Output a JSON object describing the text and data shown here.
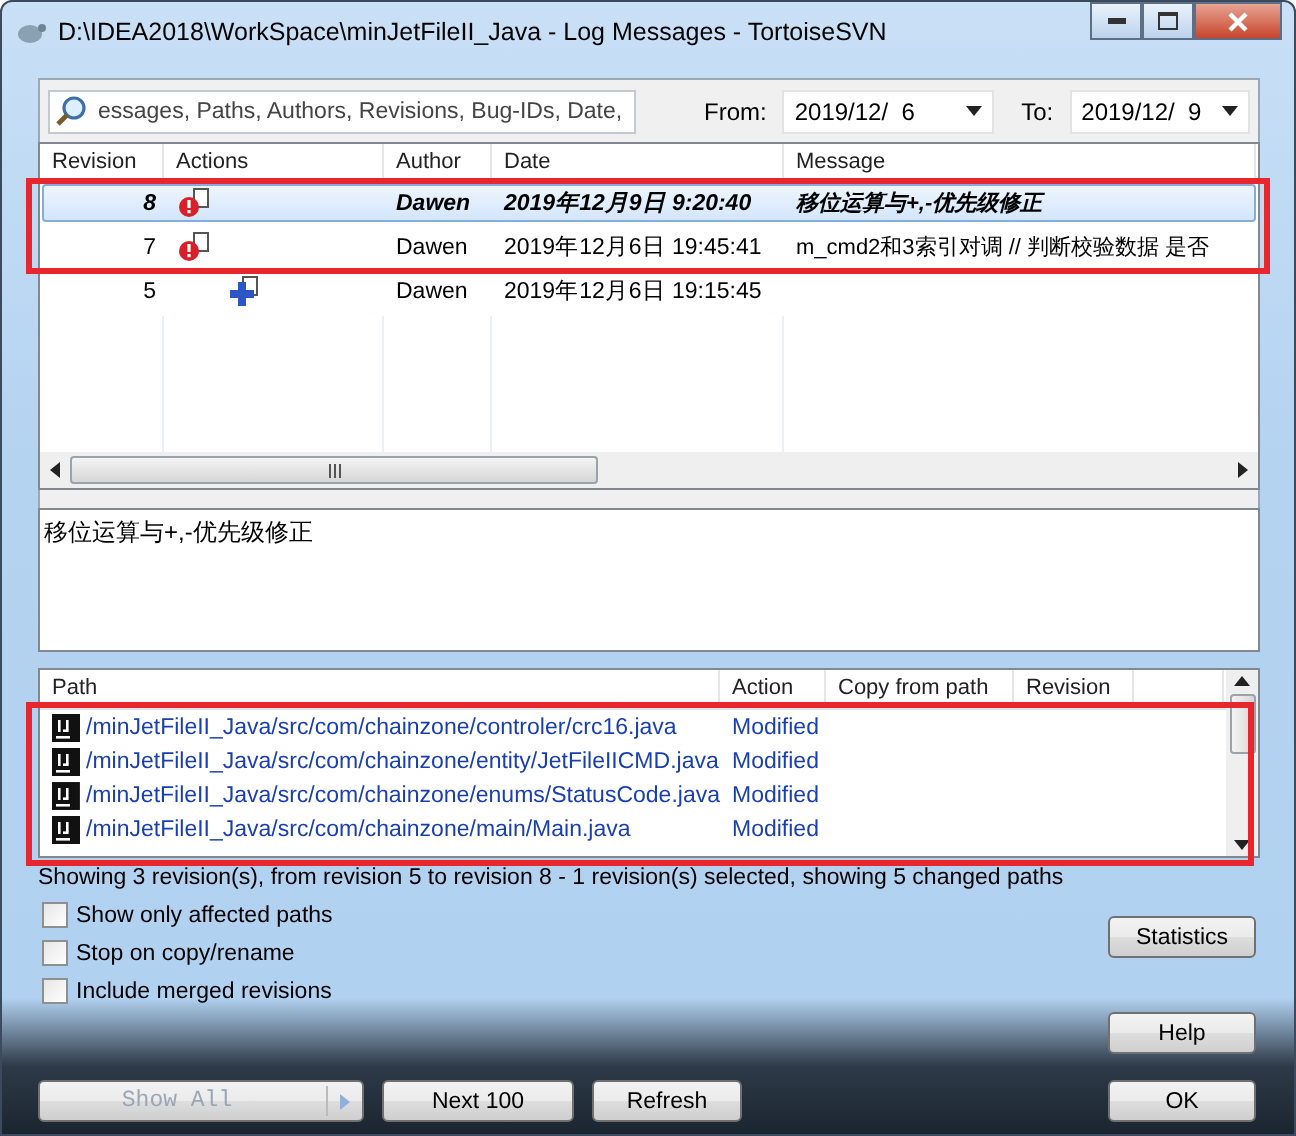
{
  "window": {
    "title": "D:\\IDEA2018\\WorkSpace\\minJetFileII_Java - Log Messages - TortoiseSVN"
  },
  "filter": {
    "placeholder": "essages, Paths, Authors, Revisions, Bug-IDs, Date,",
    "from_label": "From:",
    "from_value": "2019/12/  6",
    "to_label": "To:",
    "to_value": "2019/12/  9"
  },
  "log": {
    "columns": [
      "Revision",
      "Actions",
      "Author",
      "Date",
      "Message"
    ],
    "rows": [
      {
        "revision": "8",
        "kind": "modified",
        "author": "Dawen",
        "date": "2019年12月9日 9:20:40",
        "message": "移位运算与+,-优先级修正",
        "selected": true,
        "current": true
      },
      {
        "revision": "7",
        "kind": "modified",
        "author": "Dawen",
        "date": "2019年12月6日 19:45:41",
        "message": "m_cmd2和3索引对调 // 判断校验数据 是否",
        "selected": false,
        "current": false
      },
      {
        "revision": "5",
        "kind": "added",
        "author": "Dawen",
        "date": "2019年12月6日 19:15:45",
        "message": "",
        "selected": false,
        "current": false
      }
    ]
  },
  "message_text": "移位运算与+,-优先级修正",
  "paths": {
    "columns": [
      "Path",
      "Action",
      "Copy from path",
      "Revision"
    ],
    "rows": [
      {
        "path": "/minJetFileII_Java/src/com/chainzone/controler/crc16.java",
        "action": "Modified"
      },
      {
        "path": "/minJetFileII_Java/src/com/chainzone/entity/JetFileIICMD.java",
        "action": "Modified"
      },
      {
        "path": "/minJetFileII_Java/src/com/chainzone/enums/StatusCode.java",
        "action": "Modified"
      },
      {
        "path": "/minJetFileII_Java/src/com/chainzone/main/Main.java",
        "action": "Modified"
      }
    ]
  },
  "status": "Showing 3 revision(s), from revision 5 to revision 8 - 1 revision(s) selected, showing 5 changed paths",
  "options": [
    {
      "label": "Show only affected paths",
      "checked": false
    },
    {
      "label": "Stop on copy/rename",
      "checked": false
    },
    {
      "label": "Include merged revisions",
      "checked": false
    }
  ],
  "side_buttons": [
    {
      "label": "Statistics"
    },
    {
      "label": "Help"
    }
  ],
  "bottom_buttons": [
    {
      "label": "Show All",
      "kind": "split",
      "disabled": true
    },
    {
      "label": "Next 100",
      "kind": "plain",
      "disabled": false
    },
    {
      "label": "Refresh",
      "kind": "plain",
      "disabled": false
    }
  ],
  "ok_button": {
    "label": "OK"
  }
}
